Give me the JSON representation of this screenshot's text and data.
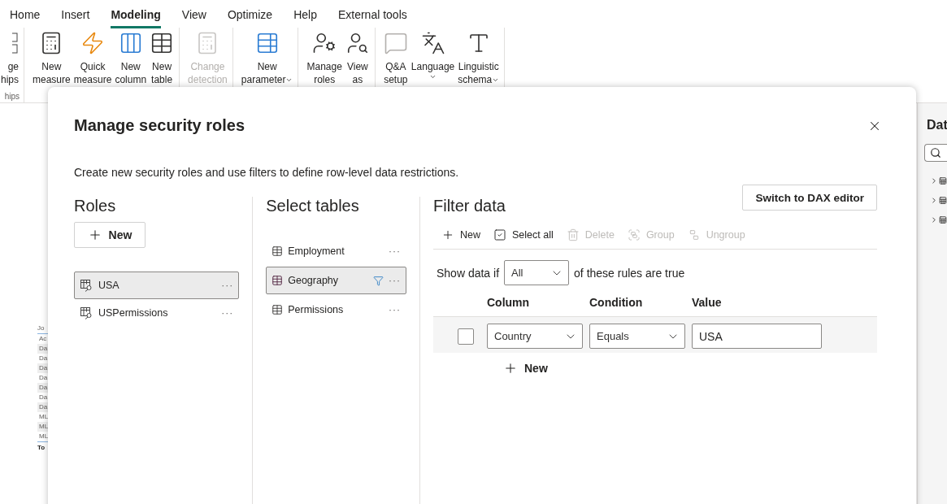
{
  "ribbon": {
    "tabs": [
      {
        "label": "Home",
        "selected": false
      },
      {
        "label": "Insert",
        "selected": false
      },
      {
        "label": "Modeling",
        "selected": true
      },
      {
        "label": "View",
        "selected": false
      },
      {
        "label": "Optimize",
        "selected": false
      },
      {
        "label": "Help",
        "selected": false
      },
      {
        "label": "External tools",
        "selected": false
      }
    ],
    "groups": [
      {
        "label": "hips",
        "buttons": [
          {
            "kind": "partial",
            "lines": [
              "ge",
              "hips"
            ],
            "disabled": false,
            "menu": false
          }
        ]
      },
      {
        "buttons": [
          {
            "kind": "calculator",
            "lines": [
              "New",
              "measure"
            ],
            "disabled": false,
            "menu": false
          },
          {
            "kind": "quick",
            "lines": [
              "Quick",
              "measure"
            ],
            "disabled": false,
            "menu": false
          },
          {
            "kind": "column",
            "lines": [
              "New",
              "column"
            ],
            "disabled": false,
            "menu": false
          },
          {
            "kind": "table",
            "lines": [
              "New",
              "table"
            ],
            "disabled": false,
            "menu": false
          }
        ]
      },
      {
        "buttons": [
          {
            "kind": "calculator",
            "lines": [
              "Change",
              "detection"
            ],
            "disabled": true,
            "menu": false
          }
        ]
      },
      {
        "buttons": [
          {
            "kind": "parameter",
            "lines": [
              "New",
              "parameter"
            ],
            "disabled": false,
            "menu": true
          }
        ]
      },
      {
        "buttons": [
          {
            "kind": "roles",
            "lines": [
              "Manage",
              "roles"
            ],
            "disabled": false,
            "menu": false
          },
          {
            "kind": "viewas",
            "lines": [
              "View",
              "as"
            ],
            "disabled": false,
            "menu": false
          }
        ]
      },
      {
        "buttons": [
          {
            "kind": "qa",
            "lines": [
              "Q&A",
              "setup"
            ],
            "disabled": false,
            "menu": false
          },
          {
            "kind": "language",
            "lines": [
              "Language"
            ],
            "disabled": false,
            "menu": true
          },
          {
            "kind": "schema",
            "lines": [
              "Linguistic",
              "schema"
            ],
            "disabled": false,
            "menu": true
          }
        ]
      }
    ]
  },
  "canvas": {
    "table_header": "Jo",
    "table_rows": [
      "Ac",
      "Da",
      "Da",
      "Da",
      "Da",
      "Da",
      "Da",
      "Da",
      "ML",
      "ML",
      "ML"
    ],
    "table_total": "To"
  },
  "data_pane": {
    "title": "Dat",
    "tree_items": [
      {
        "expanded": false
      },
      {
        "expanded": false
      },
      {
        "expanded": false
      }
    ]
  },
  "dialog": {
    "title": "Manage security roles",
    "description": "Create new security roles and use filters to define row-level data restrictions.",
    "roles": {
      "heading": "Roles",
      "new_button": "New",
      "items": [
        {
          "name": "USA",
          "selected": true,
          "more": "···"
        },
        {
          "name": "USPermissions",
          "selected": false,
          "more": "···"
        }
      ]
    },
    "tables": {
      "heading": "Select tables",
      "items": [
        {
          "name": "Employment",
          "selected": false,
          "filtered": false,
          "more": "···"
        },
        {
          "name": "Geography",
          "selected": true,
          "filtered": true,
          "more": "···"
        },
        {
          "name": "Permissions",
          "selected": false,
          "filtered": false,
          "more": "···"
        }
      ]
    },
    "filter": {
      "heading": "Filter data",
      "dax_button": "Switch to DAX editor",
      "toolbar": [
        {
          "kind": "new",
          "label": "New",
          "disabled": false
        },
        {
          "kind": "selectall",
          "label": "Select all",
          "disabled": false
        },
        {
          "kind": "delete",
          "label": "Delete",
          "disabled": true
        },
        {
          "kind": "group",
          "label": "Group",
          "disabled": true
        },
        {
          "kind": "ungroup",
          "label": "Ungroup",
          "disabled": true
        }
      ],
      "show_data_prefix": "Show data if",
      "match": "All",
      "show_data_suffix": "of these rules are true",
      "columns": [
        "Column",
        "Condition",
        "Value"
      ],
      "rules": [
        {
          "checked": false,
          "column": "Country",
          "condition": "Equals",
          "value": "USA"
        }
      ],
      "add_rule": "New"
    }
  }
}
